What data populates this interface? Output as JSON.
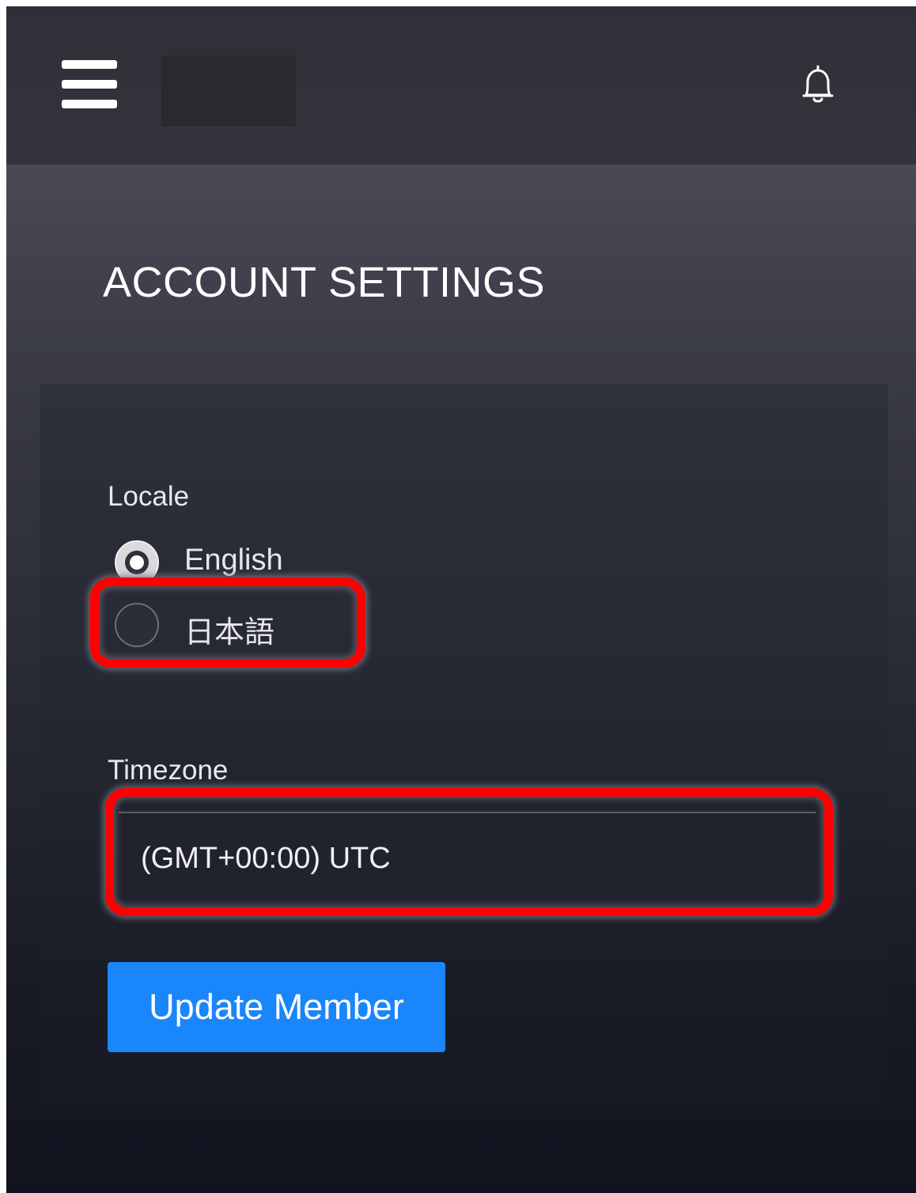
{
  "page": {
    "title": "ACCOUNT SETTINGS"
  },
  "topbar": {
    "menu_icon": "hamburger-menu-icon",
    "notification_icon": "bell-icon"
  },
  "form": {
    "locale": {
      "label": "Locale",
      "options": [
        {
          "label": "English",
          "checked": true
        },
        {
          "label": "日本語",
          "checked": false
        }
      ]
    },
    "timezone": {
      "label": "Timezone",
      "value": "(GMT+00:00) UTC"
    },
    "submit_label": "Update Member"
  },
  "colors": {
    "accent": "#1a86fb",
    "highlight": "#ff0000"
  }
}
